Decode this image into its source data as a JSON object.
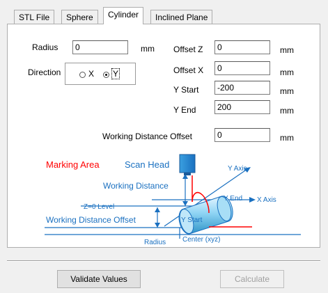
{
  "tabs": [
    {
      "label": "STL File",
      "active": false
    },
    {
      "label": "Sphere",
      "active": false
    },
    {
      "label": "Cylinder",
      "active": true
    },
    {
      "label": "Inclined Plane",
      "active": false
    }
  ],
  "form": {
    "radius": {
      "label": "Radius",
      "value": "0",
      "unit": "mm"
    },
    "direction": {
      "label": "Direction",
      "options": [
        "X",
        "Y"
      ],
      "selected": "Y"
    },
    "offset_z": {
      "label": "Offset Z",
      "value": "0",
      "unit": "mm"
    },
    "offset_x": {
      "label": "Offset X",
      "value": "0",
      "unit": "mm"
    },
    "y_start": {
      "label": "Y Start",
      "value": "-200",
      "unit": "mm"
    },
    "y_end": {
      "label": "Y End",
      "value": "200",
      "unit": "mm"
    },
    "wd_offset": {
      "label": "Working Distance Offset",
      "value": "0",
      "unit": "mm"
    }
  },
  "diagram": {
    "marking_area": "Marking Area",
    "scan_head": "Scan Head",
    "y_axis": "Y Axis",
    "working_distance": "Working Distance",
    "y_end": "Y End",
    "x_axis": "X Axis",
    "z0_level": "Z=0 Level",
    "wd_offset": "Working Distance Offset",
    "y_start": "Y Start",
    "radius": "Radius",
    "center": "Center (xyz)",
    "colors": {
      "red": "#ff0000",
      "blue": "#0000ff",
      "cyan": "#1fa0e0",
      "guide": "#2070c0"
    }
  },
  "buttons": {
    "validate": "Validate Values",
    "calculate": "Calculate",
    "calculate_enabled": false
  }
}
